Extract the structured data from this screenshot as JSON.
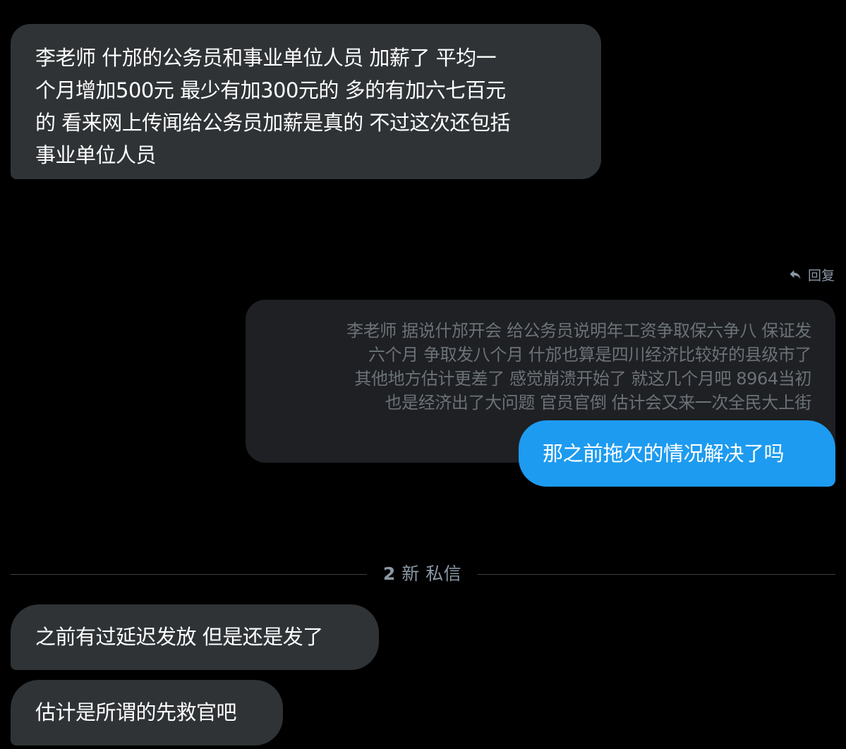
{
  "messages": {
    "first": {
      "lines": [
        "李老师 什邡的公务员和事业单位人员   加薪了 平均一",
        "个月增加500元 最少有加300元的 多的有加六七百元",
        "的 看来网上传闻给公务员加薪是真的 不过这次还包括",
        "事业单位人员"
      ]
    },
    "reply": {
      "label": "回复",
      "icon": "reply-arrow-icon",
      "quoted_lines": [
        "李老师 据说什邡开会 给公务员说明年工资争取保六争八 保证发",
        "六个月 争取发八个月 什邡也算是四川经济比较好的县级市了",
        "其他地方估计更差了 感觉崩溃开始了 就这几个月吧 8964当初",
        "也是经济出了大问题 官员官倒 估计会又来一次全民大上街"
      ],
      "text": "那之前拖欠的情况解决了吗"
    },
    "divider": {
      "count": "2",
      "label": "新 私信"
    },
    "new": [
      {
        "text": "之前有过延迟发放 但是还是发了"
      },
      {
        "text": "估计是所谓的先救官吧"
      }
    ]
  },
  "colors": {
    "background": "#000000",
    "incoming_bubble": "#2f3336",
    "quoted_bubble": "#1e2023",
    "outgoing_bubble": "#1d9bf0",
    "muted_text": "#8b98a5"
  }
}
